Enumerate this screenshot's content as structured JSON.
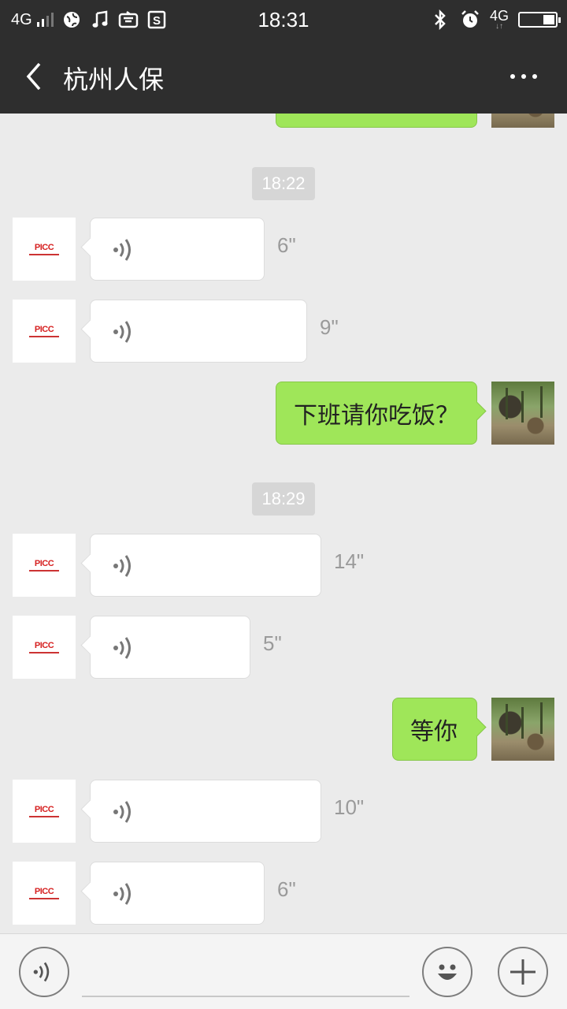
{
  "status_bar": {
    "network": "4G",
    "time": "18:31",
    "right_network": "4G",
    "icons": [
      "globe-icon",
      "music-note-icon",
      "keyboard-app-icon",
      "s-app-icon",
      "bluetooth-icon",
      "alarm-clock-icon",
      "battery-icon"
    ]
  },
  "nav": {
    "title": "杭州人保",
    "back_icon": "chevron-left-icon",
    "more_icon": "more-dots-icon"
  },
  "chat": {
    "time_labels": [
      "18:22",
      "18:29"
    ],
    "avatar_label": "PICC",
    "messages": [
      {
        "type": "voice",
        "from": "other",
        "duration": "6\""
      },
      {
        "type": "voice",
        "from": "other",
        "duration": "9\""
      },
      {
        "type": "text",
        "from": "me",
        "text": "下班请你吃饭？"
      },
      {
        "type": "voice",
        "from": "other",
        "duration": "14\""
      },
      {
        "type": "voice",
        "from": "other",
        "duration": "5\""
      },
      {
        "type": "text",
        "from": "me",
        "text": "等你"
      },
      {
        "type": "voice",
        "from": "other",
        "duration": "10\""
      },
      {
        "type": "voice",
        "from": "other",
        "duration": "6\""
      }
    ]
  },
  "input_bar": {
    "voice_icon": "voice-input-icon",
    "emoji_icon": "emoji-icon",
    "plus_icon": "plus-icon",
    "text_value": ""
  },
  "colors": {
    "header_bg": "#2e2e2e",
    "chat_bg": "#ebebeb",
    "outgoing_bubble": "#9fe659",
    "incoming_bubble": "#ffffff",
    "duration_text": "#9a9a9a"
  }
}
